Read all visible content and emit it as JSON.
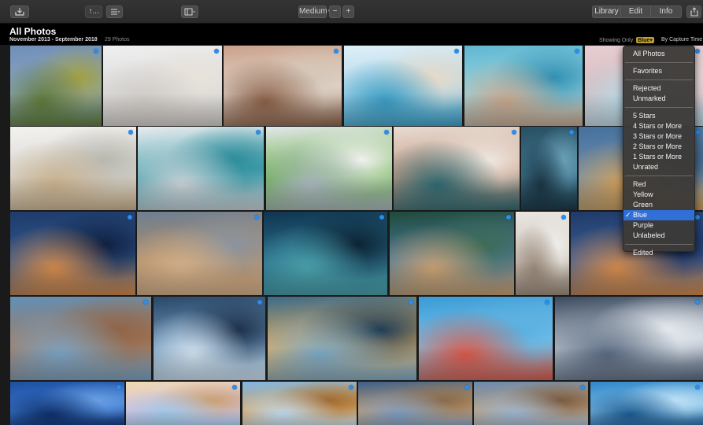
{
  "toolbar": {
    "import_icon": "import-tray-icon",
    "sort_label": "↑...",
    "size_label": "Medium",
    "zoom_out": "−",
    "zoom_in": "+",
    "tabs": [
      "Library",
      "Edit",
      "Info"
    ]
  },
  "header": {
    "title": "All Photos",
    "date_range": "November 2013 - September 2018",
    "count": "29 Photos",
    "showing_prefix": "Showing Only:",
    "showing_value": "Blue",
    "sort_text": "By Capture Time"
  },
  "filter_menu": {
    "groups": [
      [
        "All Photos"
      ],
      [
        "Favorites"
      ],
      [
        "Rejected",
        "Unmarked"
      ],
      [
        "5 Stars",
        "4 Stars or More",
        "3 Stars or More",
        "2 Stars or More",
        "1 Stars or More",
        "Unrated"
      ],
      [
        "Red",
        "Yellow",
        "Green",
        "Blue",
        "Purple",
        "Unlabeled"
      ],
      [
        "Edited"
      ]
    ],
    "selected": "Blue"
  },
  "photos": [
    {
      "label": "wheat-field-cypress",
      "colors": [
        "#6f8fb8",
        "#8fa7c2",
        "#5f7a3a",
        "#a2a040"
      ]
    },
    {
      "label": "boy-on-floor",
      "colors": [
        "#efefef",
        "#dcdcdc",
        "#cfcac5",
        "#e8e2da"
      ]
    },
    {
      "label": "girl-with-mother",
      "colors": [
        "#c9a08a",
        "#e6dcd2",
        "#8a6048",
        "#d4c6b8"
      ]
    },
    {
      "label": "sun-hats",
      "colors": [
        "#dfeff8",
        "#b0d8ea",
        "#3a9dc4",
        "#e7d9c8"
      ]
    },
    {
      "label": "woman-pool",
      "colors": [
        "#5fb7d0",
        "#9ad6e3",
        "#c7a68c",
        "#2f8fb2"
      ]
    },
    {
      "label": "woman-pink",
      "colors": [
        "#e6cfd2",
        "#d6b9bd",
        "#b9dbe7",
        "#efe2e2"
      ]
    },
    {
      "label": "baby-on-bed",
      "colors": [
        "#f3f2ef",
        "#d9d8d4",
        "#c8b08c",
        "#b8b8b0"
      ]
    },
    {
      "label": "boy-teal-sofa",
      "colors": [
        "#e9ecef",
        "#4fa5b2",
        "#c9d1d6",
        "#2b8c9a"
      ]
    },
    {
      "label": "boy-green-dinosaur",
      "colors": [
        "#e4e7ea",
        "#6ab14a",
        "#aab6bf",
        "#f1f1f0"
      ]
    },
    {
      "label": "mother-child-tree",
      "colors": [
        "#e7dcd3",
        "#c89b84",
        "#2f6a72",
        "#efe8e1"
      ]
    },
    {
      "label": "waterfall-blue",
      "colors": [
        "#2a4f63",
        "#3e7890",
        "#1c3645",
        "#6aa0b7"
      ]
    },
    {
      "label": "windmill-sunset",
      "colors": [
        "#45709c",
        "#6d8fb0",
        "#d2a05a",
        "#2b4a6b"
      ]
    },
    {
      "label": "milky-way-trees",
      "colors": [
        "#1d3b6b",
        "#32588d",
        "#d38a4a",
        "#0f2040"
      ]
    },
    {
      "label": "sand-room",
      "colors": [
        "#6c7f92",
        "#b28f6a",
        "#d3b08a",
        "#8a94a0"
      ]
    },
    {
      "label": "star-trail-tree",
      "colors": [
        "#0f3550",
        "#2c6f8c",
        "#4aa0aa",
        "#0c2232"
      ]
    },
    {
      "label": "girl-hat-denim",
      "colors": [
        "#1f4a3a",
        "#4a7b9f",
        "#c9a070",
        "#3f6b55"
      ]
    },
    {
      "label": "girl-stairs",
      "colors": [
        "#e9e6e2",
        "#cfc6bd",
        "#9a8a7a",
        "#efeeea"
      ]
    },
    {
      "label": "lighthouse-night",
      "colors": [
        "#1f3a68",
        "#3a5f9a",
        "#d38a4a",
        "#12244a"
      ]
    },
    {
      "label": "temple-square",
      "colors": [
        "#5f90b8",
        "#a77a5a",
        "#7aa3c4",
        "#8f6548"
      ]
    },
    {
      "label": "glass-building",
      "colors": [
        "#2a4868",
        "#6e96ba",
        "#cfe0ee",
        "#1b2f48"
      ]
    },
    {
      "label": "bridge-sunset",
      "colors": [
        "#3a6a8a",
        "#e8b060",
        "#7aa8c6",
        "#1e3c54"
      ]
    },
    {
      "label": "colorful-houses",
      "colors": [
        "#3a9bd6",
        "#7ac4ea",
        "#d85a4a",
        "#5ab0e0"
      ]
    },
    {
      "label": "white-sails-storm",
      "colors": [
        "#3a4a5f",
        "#c6ced8",
        "#5a6a80",
        "#e6eaef"
      ]
    },
    {
      "label": "blue-tower",
      "colors": [
        "#1d4fa0",
        "#3a78d0",
        "#0f2f68",
        "#6aa0e4"
      ]
    },
    {
      "label": "glass-dome",
      "colors": [
        "#f0d9b0",
        "#d8c0e0",
        "#9fc8e6",
        "#c9a070"
      ]
    },
    {
      "label": "giraffe-sky",
      "colors": [
        "#7fb7e6",
        "#d9a35a",
        "#bcd9f0",
        "#a06a30"
      ]
    },
    {
      "label": "desert-road",
      "colors": [
        "#3a5f8a",
        "#c9a070",
        "#7a9ac0",
        "#8a6a4a"
      ]
    },
    {
      "label": "canyon-clouds",
      "colors": [
        "#6a8ab0",
        "#c0a07a",
        "#9ab4cf",
        "#7a5a40"
      ]
    },
    {
      "label": "blue-lake-mountain",
      "colors": [
        "#2f86c8",
        "#7fc0e8",
        "#1e5a90",
        "#bfe0f4"
      ]
    }
  ]
}
